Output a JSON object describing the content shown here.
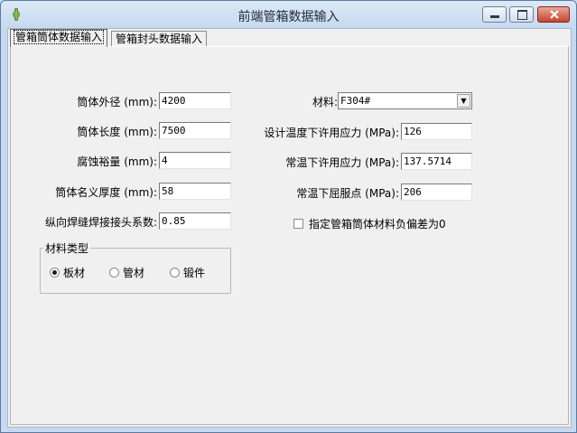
{
  "window": {
    "title": "前端管箱数据输入",
    "controls": {
      "minimize": "▬",
      "maximize": "▢",
      "close": "✕"
    },
    "icon": "app-icon"
  },
  "tabs": [
    {
      "label": "管箱筒体数据输入",
      "active": true
    },
    {
      "label": "管箱封头数据输入",
      "active": false
    }
  ],
  "left_fields": [
    {
      "label": "筒体外径 (mm):",
      "value": "4200"
    },
    {
      "label": "筒体长度 (mm):",
      "value": "7500"
    },
    {
      "label": "腐蚀裕量 (mm):",
      "value": "4"
    },
    {
      "label": "筒体名义厚度 (mm):",
      "value": "58"
    },
    {
      "label": "纵向焊缝焊接接头系数:",
      "value": "0.85"
    }
  ],
  "material_type": {
    "legend": "材料类型",
    "options": [
      {
        "label": "板材",
        "selected": true
      },
      {
        "label": "管材",
        "selected": false
      },
      {
        "label": "锻件",
        "selected": false
      }
    ]
  },
  "right_fields": {
    "material": {
      "label": "材料:",
      "value": "F304#"
    },
    "design_temp_stress": {
      "label": "设计温度下许用应力 (MPa):",
      "value": "126"
    },
    "room_temp_stress": {
      "label": "常温下许用应力 (MPa):",
      "value": "137.5714"
    },
    "room_temp_yield": {
      "label": "常温下屈服点 (MPa):",
      "value": "206"
    }
  },
  "negative_tolerance": {
    "label": "指定管箱筒体材料负偏差为0",
    "checked": false
  }
}
